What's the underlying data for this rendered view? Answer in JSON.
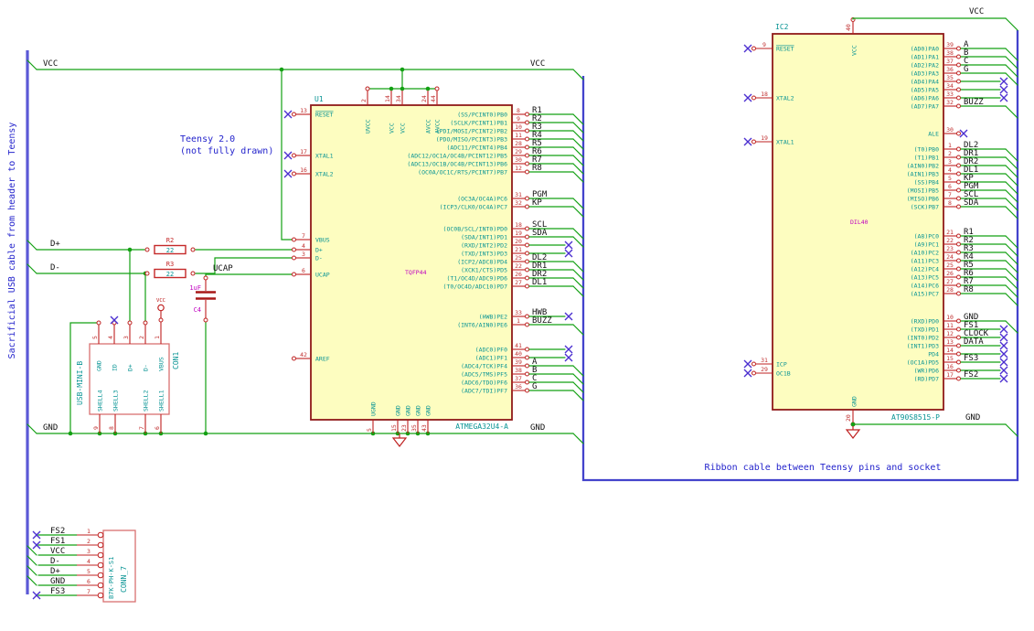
{
  "notes": {
    "left_vertical": "Sacrificial USB cable from header to Teensy",
    "teensy_line1": "Teensy 2.0",
    "teensy_line2": "(not fully drawn)",
    "ribbon": "Ribbon cable between Teensy pins and socket"
  },
  "colors": {
    "wire": "#13a013",
    "bus": "#4343cc",
    "body_fill": "#fdfdc0",
    "body_outline": "#8f1a1a",
    "pin_name": "#089494",
    "pin_number": "#c03030",
    "note": "#2424cc",
    "no_connect": "#4b2fd0"
  },
  "rails": {
    "vcc_left": "VCC",
    "vcc_right": "VCC",
    "gnd_left": "GND",
    "gnd_right": "GND",
    "dplus": "D+",
    "dminus": "D-",
    "ucap": "UCAP",
    "ic2_vcc": "VCC",
    "ic2_gnd": "GND"
  },
  "u1": {
    "ref": "U1",
    "value": "ATMEGA32U4-A",
    "footprint": "TQFP44",
    "left_pins": [
      {
        "n": "13",
        "name": "RESET"
      },
      {
        "n": "17",
        "name": "XTAL1"
      },
      {
        "n": "16",
        "name": "XTAL2"
      },
      {
        "n": "7",
        "name": "VBUS"
      },
      {
        "n": "4",
        "name": "D+"
      },
      {
        "n": "3",
        "name": "D-"
      },
      {
        "n": "6",
        "name": "UCAP"
      },
      {
        "n": "42",
        "name": "AREF"
      }
    ],
    "top_pins": [
      {
        "n": "2",
        "name": "UVCC"
      },
      {
        "n": "14",
        "name": "VCC"
      },
      {
        "n": "34",
        "name": "VCC"
      },
      {
        "n": "24",
        "name": "AVCC"
      },
      {
        "n": "44",
        "name": "AVCC"
      }
    ],
    "bottom_pins": [
      {
        "n": "5",
        "name": "UGND"
      },
      {
        "n": "15",
        "name": "GND"
      },
      {
        "n": "23",
        "name": "GND"
      },
      {
        "n": "35",
        "name": "GND"
      },
      {
        "n": "43",
        "name": "GND"
      }
    ],
    "pb": [
      {
        "n": "8",
        "fn": "(SS/PCINT0)PB0",
        "l": "R1",
        "term": "bus"
      },
      {
        "n": "9",
        "fn": "(SCLK/PCINT1)PB1",
        "l": "R2",
        "term": "bus"
      },
      {
        "n": "10",
        "fn": "(PDI/MOSI/PCINT2)PB2",
        "l": "R3",
        "term": "bus"
      },
      {
        "n": "11",
        "fn": "(PDO/MISO/PCINT3)PB3",
        "l": "R4",
        "term": "bus"
      },
      {
        "n": "28",
        "fn": "(ADC11/PCINT4)PB4",
        "l": "R5",
        "term": "bus"
      },
      {
        "n": "29",
        "fn": "(ADC12/OC1A/OC4B/PCINT12)PB5",
        "l": "R6",
        "term": "bus"
      },
      {
        "n": "30",
        "fn": "(ADC13/OC1B/OC4B/PCINT13)PB6",
        "l": "R7",
        "term": "bus"
      },
      {
        "n": "12",
        "fn": "(OC0A/OC1C/RTS/PCINT7)PB7",
        "l": "R8",
        "term": "bus"
      }
    ],
    "pc": [
      {
        "n": "31",
        "fn": "(OC3A/OC4A)PC6",
        "l": "PGM",
        "term": "bus"
      },
      {
        "n": "32",
        "fn": "(ICP3/CLK0/OC4A)PC7",
        "l": "KP",
        "term": "bus"
      }
    ],
    "pd": [
      {
        "n": "18",
        "fn": "(OC0B/SCL/INT0)PD0",
        "l": "SCL",
        "term": "bus"
      },
      {
        "n": "19",
        "fn": "(SDA/INT1)PD1",
        "l": "SDA",
        "term": "bus"
      },
      {
        "n": "20",
        "fn": "(RXD/INT2)PD2",
        "l": "",
        "term": "x"
      },
      {
        "n": "21",
        "fn": "(TXD/INT3)PD3",
        "l": "",
        "term": "x"
      },
      {
        "n": "25",
        "fn": "(ICP2/ADC8)PD4",
        "l": "DL2",
        "term": "bus"
      },
      {
        "n": "22",
        "fn": "(XCK1/CTS)PD5",
        "l": "DR1",
        "term": "bus"
      },
      {
        "n": "26",
        "fn": "(T1/OC4D/ADC9)PD6",
        "l": "DR2",
        "term": "bus"
      },
      {
        "n": "27",
        "fn": "(T0/OC4D/ADC10)PD7",
        "l": "DL1",
        "term": "bus"
      }
    ],
    "pe": [
      {
        "n": "33",
        "fn": "(HWB)PE2",
        "l": "HWB",
        "term": "x"
      },
      {
        "n": "1",
        "fn": "(INT6/AIN0)PE6",
        "l": "BUZZ",
        "term": "bus"
      }
    ],
    "pf": [
      {
        "n": "41",
        "fn": "(ADC0)PF0",
        "l": "",
        "term": "x"
      },
      {
        "n": "40",
        "fn": "(ADC1)PF1",
        "l": "",
        "term": "x"
      },
      {
        "n": "39",
        "fn": "(ADC4/TCK)PF4",
        "l": "A",
        "term": "bus"
      },
      {
        "n": "38",
        "fn": "(ADC5/TMS)PF5",
        "l": "B",
        "term": "bus"
      },
      {
        "n": "37",
        "fn": "(ADC6/TDO)PF6",
        "l": "C",
        "term": "bus"
      },
      {
        "n": "36",
        "fn": "(ADC7/TDI)PF7",
        "l": "G",
        "term": "bus"
      }
    ]
  },
  "r2": {
    "ref": "R2",
    "value": "22"
  },
  "r3": {
    "ref": "R3",
    "value": "22"
  },
  "c4": {
    "ref": "C4",
    "value": "1uF"
  },
  "con1": {
    "ref": "CON1",
    "value": "USB-MINI-B",
    "vcc_symbol": "VCC",
    "top_pins": [
      {
        "n": "5",
        "name": "GND"
      },
      {
        "n": "4",
        "name": "ID"
      },
      {
        "n": "3",
        "name": "D+"
      },
      {
        "n": "2",
        "name": "D-"
      },
      {
        "n": "1",
        "name": "VBUS"
      }
    ],
    "bottom_pins": [
      {
        "n": "9",
        "name": "SHELL4"
      },
      {
        "n": "8",
        "name": "SHELL3"
      },
      {
        "n": "7",
        "name": "SHELL2"
      },
      {
        "n": "6",
        "name": "SHELL1"
      }
    ]
  },
  "conn7": {
    "ref": "CONN_7",
    "value": "B7K-PH-K-S1",
    "pins": [
      {
        "n": "1",
        "l": "FS2",
        "term": "x"
      },
      {
        "n": "2",
        "l": "FS1",
        "term": "x"
      },
      {
        "n": "3",
        "l": "VCC",
        "term": "bus"
      },
      {
        "n": "4",
        "l": "D-",
        "term": "bus"
      },
      {
        "n": "5",
        "l": "D+",
        "term": "bus"
      },
      {
        "n": "6",
        "l": "GND",
        "term": "bus"
      },
      {
        "n": "7",
        "l": "FS3",
        "term": "x"
      }
    ]
  },
  "ic2": {
    "ref": "IC2",
    "value": "AT90S8515-P",
    "footprint": "DIL40",
    "left_pins": [
      {
        "n": "9",
        "name": "RESET"
      },
      {
        "n": "18",
        "name": "XTAL2"
      },
      {
        "n": "19",
        "name": "XTAL1"
      },
      {
        "n": "31",
        "name": "ICP"
      },
      {
        "n": "29",
        "name": "OC1B"
      }
    ],
    "top_pin": {
      "n": "40",
      "name": "VCC"
    },
    "bottom_pin": {
      "n": "20",
      "name": "GND"
    },
    "ale": {
      "n": "30",
      "fn": "ALE"
    },
    "pa": [
      {
        "n": "39",
        "fn": "(AD0)PA0",
        "l": "A",
        "term": "bus"
      },
      {
        "n": "38",
        "fn": "(AD1)PA1",
        "l": "B",
        "term": "bus"
      },
      {
        "n": "37",
        "fn": "(AD2)PA2",
        "l": "C",
        "term": "bus"
      },
      {
        "n": "36",
        "fn": "(AD3)PA3",
        "l": "G",
        "term": "bus"
      },
      {
        "n": "35",
        "fn": "(AD4)PA4",
        "l": "",
        "term": "x"
      },
      {
        "n": "34",
        "fn": "(AD5)PA5",
        "l": "",
        "term": "x"
      },
      {
        "n": "33",
        "fn": "(AD6)PA6",
        "l": "",
        "term": "x"
      },
      {
        "n": "32",
        "fn": "(AD7)PA7",
        "l": "BUZZ",
        "term": "bus"
      }
    ],
    "pb": [
      {
        "n": "1",
        "fn": "(T0)PB0",
        "l": "DL2",
        "term": "bus"
      },
      {
        "n": "2",
        "fn": "(T1)PB1",
        "l": "DR1",
        "term": "bus"
      },
      {
        "n": "3",
        "fn": "(AIN0)PB2",
        "l": "DR2",
        "term": "bus"
      },
      {
        "n": "4",
        "fn": "(AIN1)PB3",
        "l": "DL1",
        "term": "bus"
      },
      {
        "n": "5",
        "fn": "(SS)PB4",
        "l": "KP",
        "term": "bus"
      },
      {
        "n": "6",
        "fn": "(MOSI)PB5",
        "l": "PGM",
        "term": "bus"
      },
      {
        "n": "7",
        "fn": "(MISO)PB6",
        "l": "SCL",
        "term": "bus"
      },
      {
        "n": "8",
        "fn": "(SCK)PB7",
        "l": "SDA",
        "term": "bus"
      }
    ],
    "pc": [
      {
        "n": "21",
        "fn": "(A8)PC0",
        "l": "R1",
        "term": "bus"
      },
      {
        "n": "22",
        "fn": "(A9)PC1",
        "l": "R2",
        "term": "bus"
      },
      {
        "n": "23",
        "fn": "(A10)PC2",
        "l": "R3",
        "term": "bus"
      },
      {
        "n": "24",
        "fn": "(A11)PC3",
        "l": "R4",
        "term": "bus"
      },
      {
        "n": "25",
        "fn": "(A12)PC4",
        "l": "R5",
        "term": "bus"
      },
      {
        "n": "26",
        "fn": "(A13)PC5",
        "l": "R6",
        "term": "bus"
      },
      {
        "n": "27",
        "fn": "(A14)PC6",
        "l": "R7",
        "term": "bus"
      },
      {
        "n": "28",
        "fn": "(A15)PC7",
        "l": "R8",
        "term": "bus"
      }
    ],
    "pd": [
      {
        "n": "10",
        "fn": "(RXD)PD0",
        "l": "GND",
        "term": "bus"
      },
      {
        "n": "11",
        "fn": "(TXD)PD1",
        "l": "FS1",
        "term": "x"
      },
      {
        "n": "12",
        "fn": "(INT0)PD2",
        "l": "CLOCK",
        "term": "x"
      },
      {
        "n": "13",
        "fn": "(INT1)PD3",
        "l": "DATA",
        "term": "x"
      },
      {
        "n": "14",
        "fn": "PD4",
        "l": "",
        "term": "x"
      },
      {
        "n": "15",
        "fn": "(OC1A)PD5",
        "l": "FS3",
        "term": "x"
      },
      {
        "n": "16",
        "fn": "(WR)PD6",
        "l": "",
        "term": "x"
      },
      {
        "n": "17",
        "fn": "(RD)PD7",
        "l": "FS2",
        "term": "x"
      }
    ]
  }
}
